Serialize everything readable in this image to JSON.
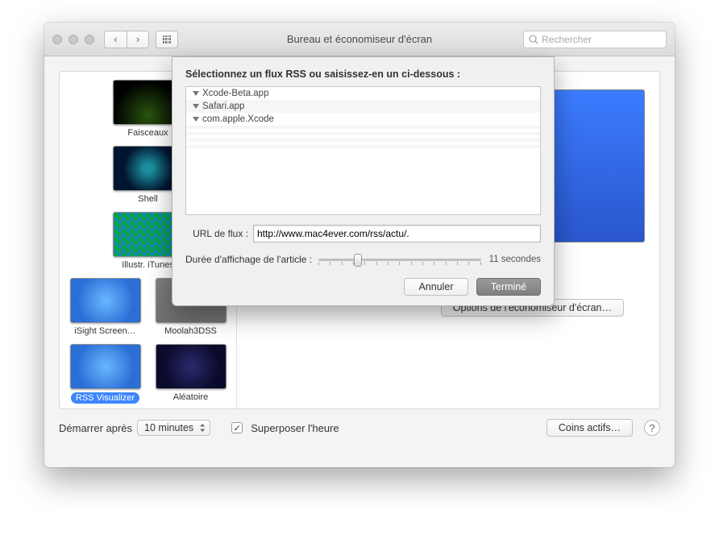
{
  "window": {
    "title": "Bureau et économiseur d'écran",
    "search_placeholder": "Rechercher"
  },
  "sidebar": {
    "items": [
      {
        "label": "Faisceaux"
      },
      {
        "label": "Shell"
      },
      {
        "label": "Illustr. iTunes"
      },
      {
        "label": "iSight Screen…"
      },
      {
        "label": "Moolah3DSS"
      },
      {
        "label": "RSS Visualizer"
      },
      {
        "label": "Aléatoire"
      }
    ]
  },
  "preview": {
    "options_label": "Options de l'économiseur d'écran…"
  },
  "bottom": {
    "start_label": "Démarrer après",
    "start_value": "10 minutes",
    "overlay_label": "Superposer l'heure",
    "hotcorners_label": "Coins actifs…"
  },
  "sheet": {
    "title": "Sélectionnez un flux RSS ou saisissez-en un ci-dessous :",
    "sources": [
      "Xcode-Beta.app",
      "Safari.app",
      "com.apple.Xcode"
    ],
    "url_label": "URL de flux :",
    "url_value": "http://www.mac4ever.com/rss/actu/.",
    "duration_label": "Durée d'affichage de l'article :",
    "duration_value": "11 secondes",
    "cancel": "Annuler",
    "done": "Terminé"
  }
}
